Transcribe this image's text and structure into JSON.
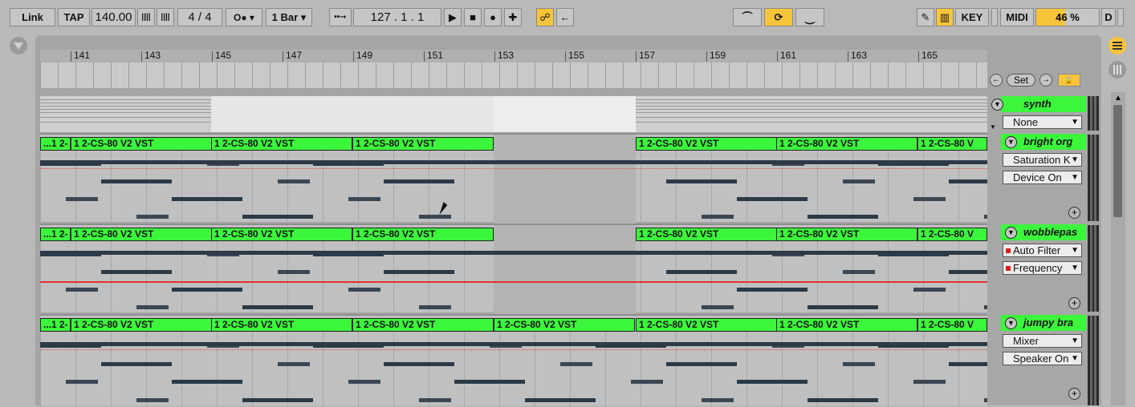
{
  "transport": {
    "link": "Link",
    "tap": "TAP",
    "tempo": "140.00",
    "time_signature": "4 / 4",
    "quantize": "1 Bar",
    "position": "127 .    1 .    1",
    "key": "KEY",
    "midi": "MIDI",
    "cpu": "46 %",
    "cpu_level": 0.46,
    "d": "D"
  },
  "ruler": {
    "bars": [
      "141",
      "143",
      "145",
      "147",
      "149",
      "151",
      "153",
      "155",
      "157",
      "159",
      "161",
      "163",
      "165"
    ]
  },
  "set": {
    "label": "Set"
  },
  "tracks": [
    {
      "name": "synth",
      "dropdowns": [
        {
          "value": "None"
        }
      ]
    },
    {
      "name": "bright org",
      "clip_name": "1 2-CS-80 V2 VST",
      "clip_prefix": "...1 2-",
      "clip_suffix": "1 2-CS-80 V",
      "dropdowns": [
        {
          "value": "Saturation K"
        },
        {
          "value": "Device On"
        }
      ]
    },
    {
      "name": "wobblepas",
      "clip_name": "1 2-CS-80 V2 VST",
      "clip_prefix": "...1 2-",
      "clip_suffix": "1 2-CS-80 V",
      "dropdowns": [
        {
          "value": "Auto Filter"
        },
        {
          "value": "Frequency"
        }
      ]
    },
    {
      "name": "jumpy bra",
      "clip_name": "1 2-CS-80 V2 VST",
      "clip_prefix": "...1 2-",
      "clip_suffix": "1 2-CS-80 V",
      "dropdowns": [
        {
          "value": "Mixer"
        },
        {
          "value": "Speaker On"
        }
      ]
    }
  ],
  "colors": {
    "clip": "#3cf63c",
    "accent": "#f8c43a",
    "automation": "#e53030"
  }
}
